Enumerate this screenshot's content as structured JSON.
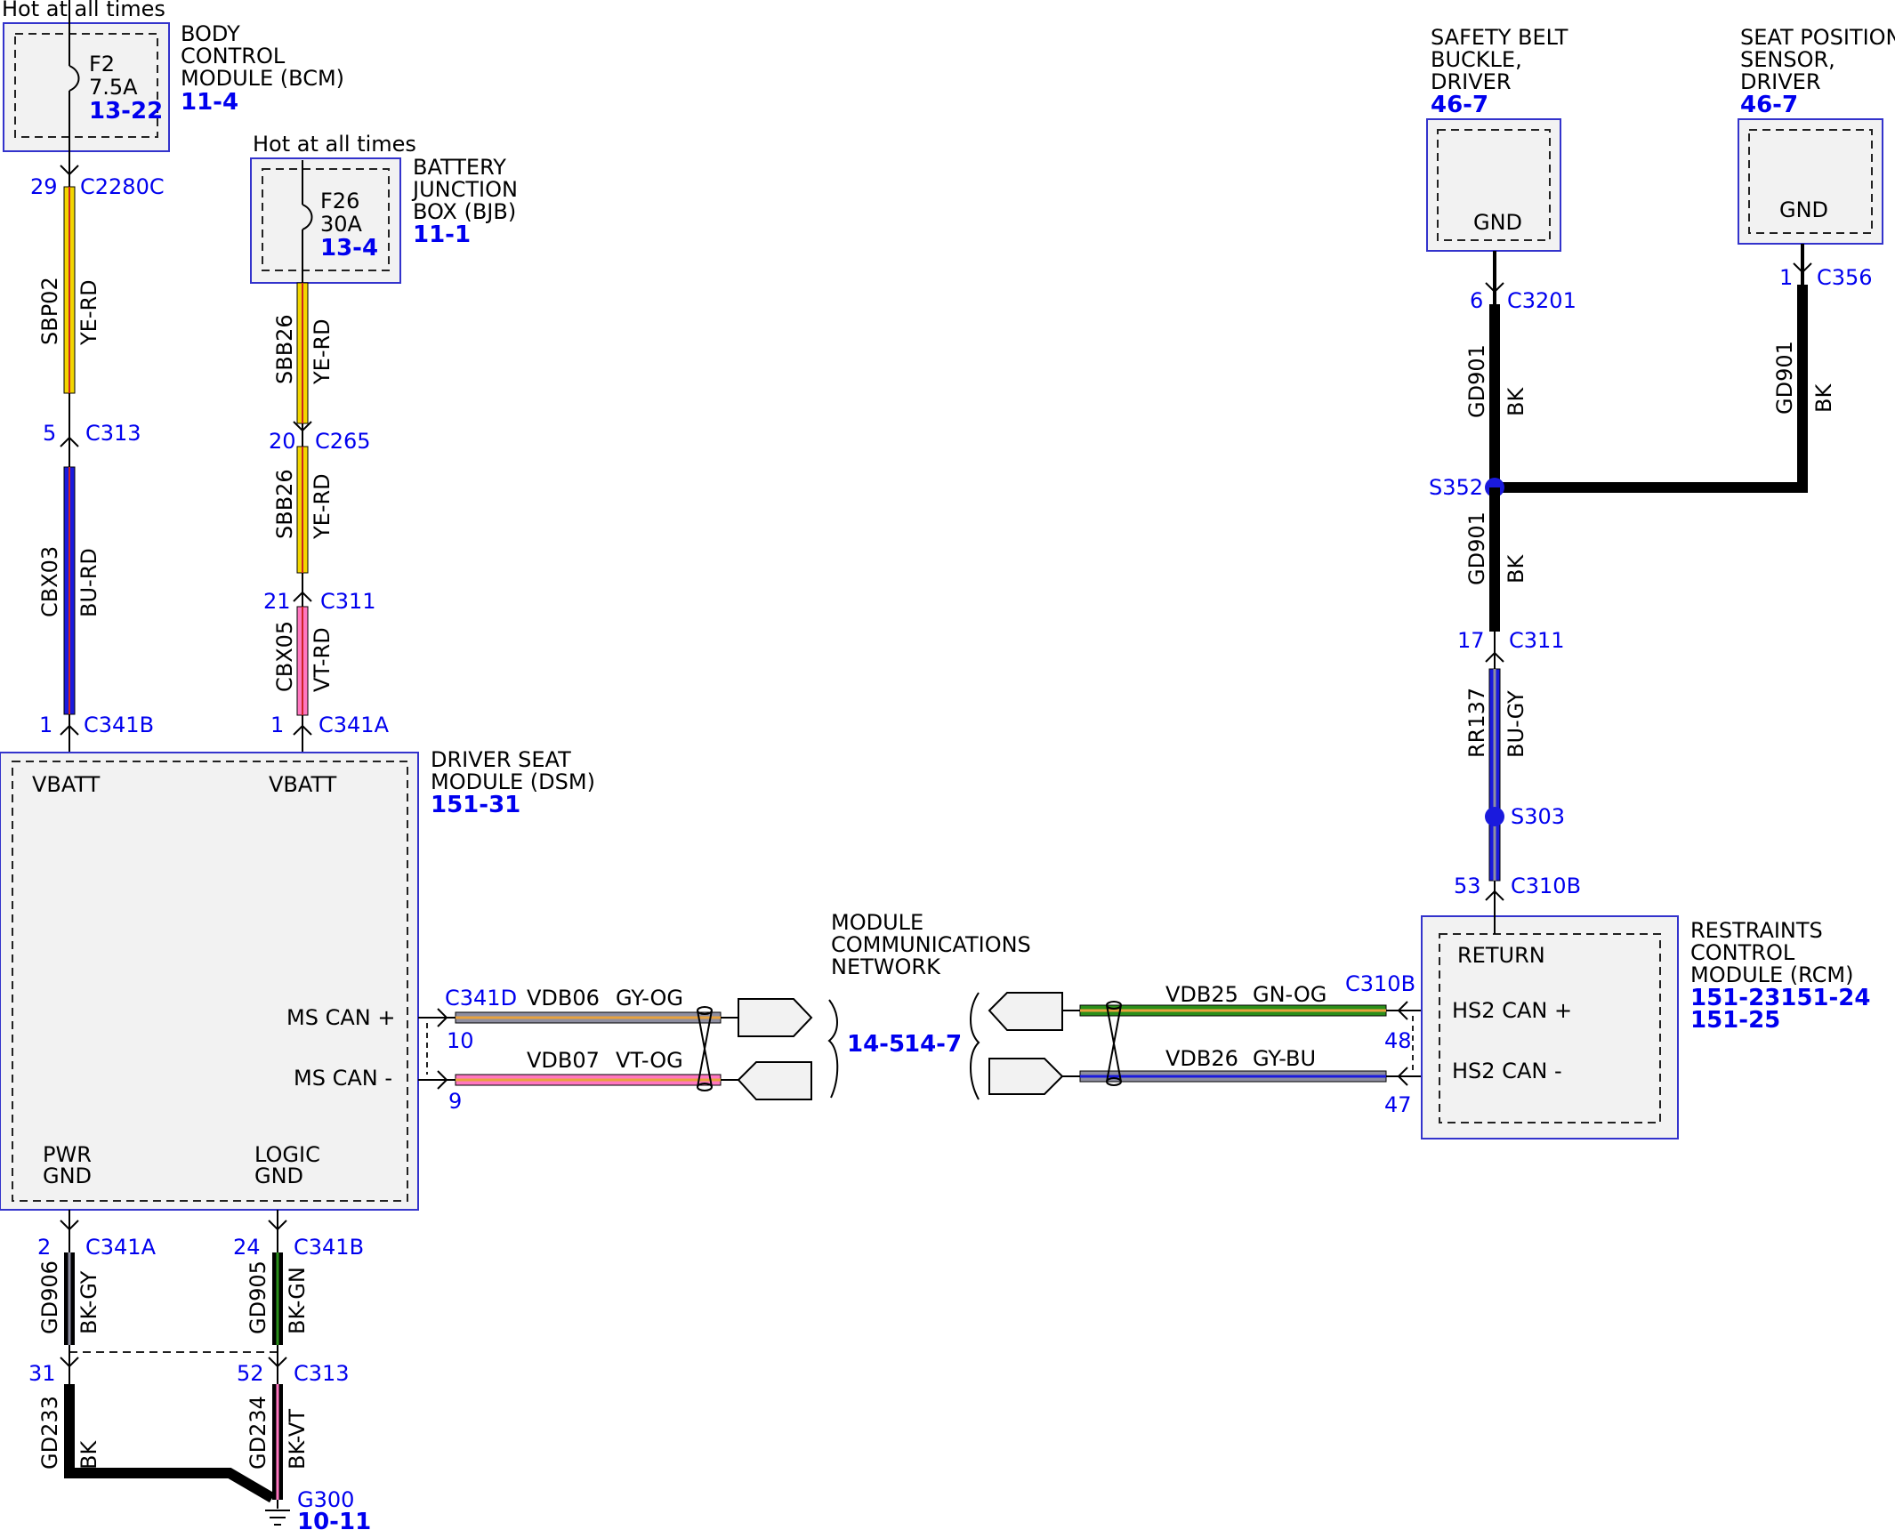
{
  "colors": {
    "YE": "#f2d600",
    "RD": "#cc2222",
    "BU": "#1a1add",
    "BK": "#000000",
    "VT": "#ff77c0",
    "GY": "#8e8ea0",
    "OG": "#e8a23c",
    "GN": "#2a8f1a",
    "pin_text": "#0000ee",
    "box_border": "#3333cc",
    "box_fill": "#f2f2f2"
  },
  "bcm": {
    "hot_label": "Hot at all times",
    "fuse_name": "F2",
    "fuse_rating": "7.5A",
    "fuse_ref": "13-22",
    "title_1": "BODY",
    "title_2": "CONTROL",
    "title_3": "MODULE (BCM)",
    "ref": "11-4"
  },
  "bjb": {
    "hot_label": "Hot at all times",
    "fuse_name": "F26",
    "fuse_rating": "30A",
    "fuse_ref": "13-4",
    "title_1": "BATTERY",
    "title_2": "JUNCTION",
    "title_3": "BOX (BJB)",
    "ref": "11-1"
  },
  "buckle": {
    "title_1": "SAFETY BELT",
    "title_2": "BUCKLE,",
    "title_3": "DRIVER",
    "ref": "46-7",
    "pin_label": "GND"
  },
  "seatpos": {
    "title_1": "SEAT POSITION",
    "title_2": "SENSOR,",
    "title_3": "DRIVER",
    "ref": "46-7",
    "pin_label": "GND"
  },
  "dsm": {
    "title_1": "DRIVER SEAT",
    "title_2": "MODULE (DSM)",
    "ref": "151-31",
    "vbatt_1": "VBATT",
    "vbatt_2": "VBATT",
    "ms_can_plus": "MS CAN +",
    "ms_can_minus": "MS CAN -",
    "pwr_1": "PWR",
    "pwr_2": "GND",
    "logic_1": "LOGIC",
    "logic_2": "GND"
  },
  "rcm": {
    "title_1": "RESTRAINTS",
    "title_2": "CONTROL",
    "title_3": "MODULE (RCM)",
    "ref_1": "151-23151-24",
    "ref_2": "151-25",
    "return_label": "RETURN",
    "hs2_plus": "HS2 CAN +",
    "hs2_minus": "HS2 CAN -"
  },
  "network": {
    "title_1": "MODULE",
    "title_2": "COMMUNICATIONS",
    "title_3": "NETWORK",
    "ref_1": "14-5",
    "ref_2": "14-7"
  },
  "pins": {
    "c2280c": {
      "pin": "29",
      "conn": "C2280C"
    },
    "c313_a": {
      "pin": "5",
      "conn": "C313"
    },
    "c341b_a": {
      "pin": "1",
      "conn": "C341B"
    },
    "c265": {
      "pin": "20",
      "conn": "C265"
    },
    "c311_a": {
      "pin": "21",
      "conn": "C311"
    },
    "c341a_a": {
      "pin": "1",
      "conn": "C341A"
    },
    "c341a_b": {
      "pin": "2",
      "conn": "C341A"
    },
    "c341b_b": {
      "pin": "24",
      "conn": "C341B"
    },
    "c313_b": {
      "pin": "31",
      "conn": "C313"
    },
    "c313_c": {
      "pin": "52",
      "conn": "C313"
    },
    "c341d": {
      "conn": "C341D",
      "pin_plus": "10",
      "pin_minus": "9"
    },
    "c310b_can": {
      "conn": "C310B",
      "pin_plus": "48",
      "pin_minus": "47"
    },
    "c3201": {
      "pin": "6",
      "conn": "C3201"
    },
    "c356": {
      "pin": "1",
      "conn": "C356"
    },
    "s352": {
      "conn": "S352"
    },
    "c311_b": {
      "pin": "17",
      "conn": "C311"
    },
    "s303": {
      "conn": "S303"
    },
    "c310b_ret": {
      "pin": "53",
      "conn": "C310B"
    },
    "g300": {
      "conn": "G300",
      "ref": "10-11"
    }
  },
  "wires": {
    "sbp02": {
      "circuit": "SBP02",
      "color": "YE-RD"
    },
    "cbx03": {
      "circuit": "CBX03",
      "color": "BU-RD"
    },
    "sbb26_a": {
      "circuit": "SBB26",
      "color": "YE-RD"
    },
    "sbb26_b": {
      "circuit": "SBB26",
      "color": "YE-RD"
    },
    "cbx05": {
      "circuit": "CBX05",
      "color": "VT-RD"
    },
    "gd906": {
      "circuit": "GD906",
      "color": "BK-GY"
    },
    "gd905": {
      "circuit": "GD905",
      "color": "BK-GN"
    },
    "gd233": {
      "circuit": "GD233",
      "color": "BK"
    },
    "gd234": {
      "circuit": "GD234",
      "color": "BK-VT"
    },
    "vdb06": {
      "circuit": "VDB06",
      "color": "GY-OG"
    },
    "vdb07": {
      "circuit": "VDB07",
      "color": "VT-OG"
    },
    "vdb25": {
      "circuit": "VDB25",
      "color": "GN-OG"
    },
    "vdb26": {
      "circuit": "VDB26",
      "color": "GY-BU"
    },
    "gd901_a": {
      "circuit": "GD901",
      "color": "BK"
    },
    "gd901_b": {
      "circuit": "GD901",
      "color": "BK"
    },
    "gd901_c": {
      "circuit": "GD901",
      "color": "BK"
    },
    "rr137": {
      "circuit": "RR137",
      "color": "BU-GY"
    }
  }
}
